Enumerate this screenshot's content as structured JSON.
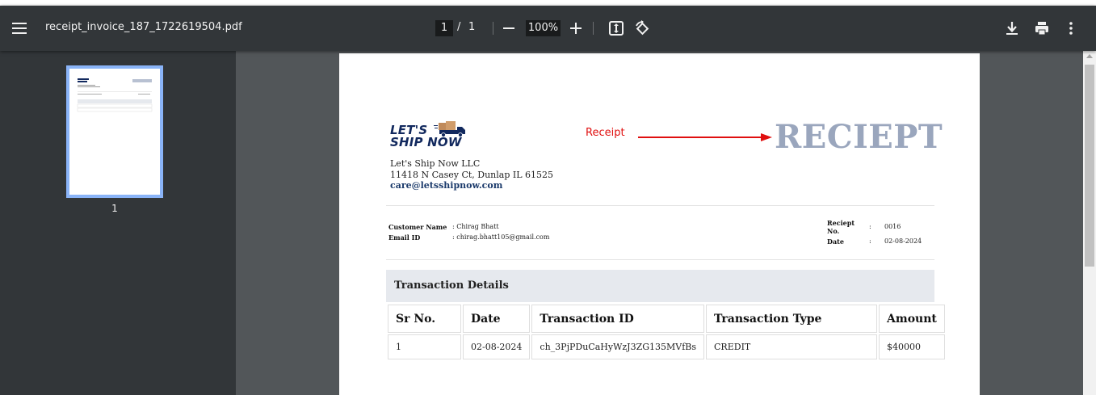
{
  "toolbar": {
    "file_name": "receipt_invoice_187_1722619504.pdf",
    "current_page": "1",
    "page_separator": "/",
    "total_pages": "1",
    "zoom": "100%"
  },
  "sidebar": {
    "thumbnail_label": "1"
  },
  "document": {
    "logo_line1": "LET'S",
    "logo_line2": "SHIP NOW",
    "company_name": "Let's Ship Now LLC",
    "company_address": "11418 N Casey Ct, Dunlap IL 61525",
    "company_email": "care@letsshipnow.com",
    "annotation": "Receipt",
    "title": "RECIEPT",
    "customer_name_label": "Customer Name",
    "customer_name_value": ": Chirag Bhatt",
    "email_label": "Email ID",
    "email_value": ": chirag.bhatt105@gmail.com",
    "receipt_no_label_1": "Reciept",
    "receipt_no_label_2": "No.",
    "receipt_no_colon": ":",
    "receipt_no_value": "0016",
    "date_label": "Date",
    "date_colon": ":",
    "date_value": "02-08-2024",
    "transaction_section_title": "Transaction Details",
    "table": {
      "headers": [
        "Sr No.",
        "Date",
        "Transaction ID",
        "Transaction Type",
        "Amount"
      ],
      "rows": [
        [
          "1",
          "02-08-2024",
          "ch_3PjPDuCaHyWzJ3ZG135MVfBs",
          "CREDIT",
          "$40000"
        ]
      ]
    }
  },
  "colors": {
    "toolbar_bg": "#323639",
    "viewer_bg": "#525659",
    "thumbnail_border": "#8ab4f8",
    "title_color": "#9aa6bd",
    "annotation_color": "#e01010",
    "logo_color": "#12295e"
  }
}
